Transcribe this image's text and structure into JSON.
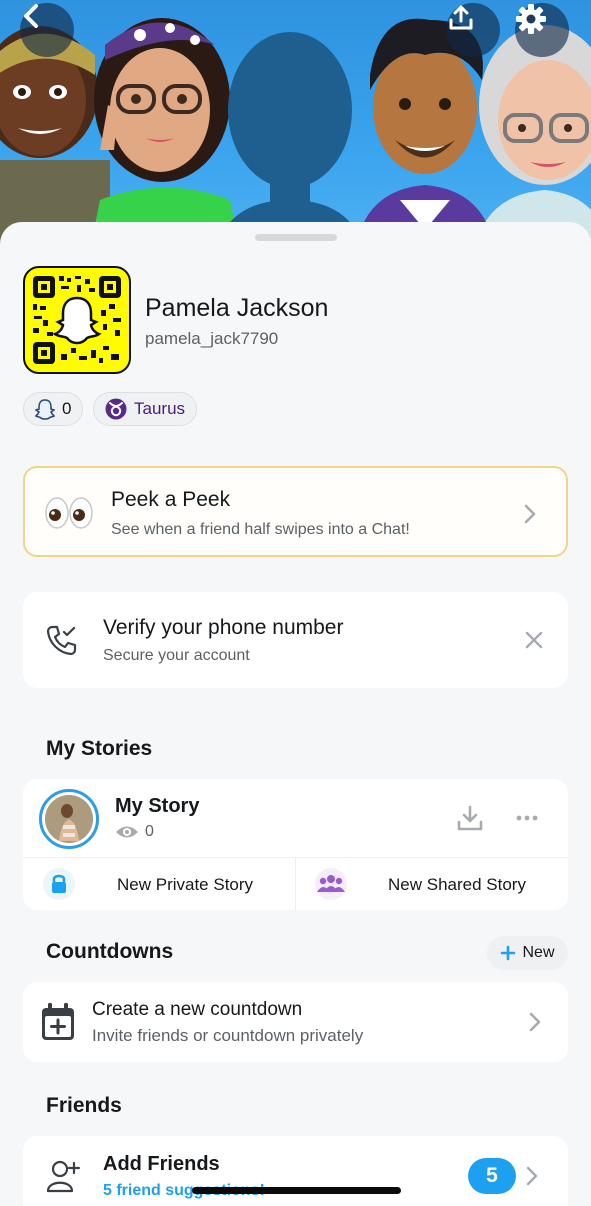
{
  "header": {
    "back_icon": "chevron-left-icon",
    "upload_icon": "upload-icon",
    "settings_icon": "gear-icon"
  },
  "profile": {
    "display_name": "Pamela Jackson",
    "username": "pamela_jack7790",
    "snap_score": "0",
    "zodiac": "Taurus"
  },
  "peek_card": {
    "title": "Peek a Peek",
    "subtitle": "See when a friend half swipes into a Chat!"
  },
  "verify_card": {
    "title": "Verify your phone number",
    "subtitle": "Secure your account"
  },
  "my_stories": {
    "heading": "My Stories",
    "story_title": "My Story",
    "view_count": "0",
    "private_label": "New Private Story",
    "shared_label": "New Shared Story"
  },
  "countdowns": {
    "heading": "Countdowns",
    "new_label": "New",
    "create_title": "Create a new countdown",
    "create_subtitle": "Invite friends or countdown privately"
  },
  "friends": {
    "heading": "Friends",
    "add_title": "Add Friends",
    "add_subtitle": "5 friend suggestions!",
    "badge_count": "5"
  },
  "colors": {
    "banner_blue": "#3aa4ee",
    "snapcode_yellow": "#fffc00",
    "accent_blue": "#1ea0f0",
    "zodiac_purple": "#4a1c7a",
    "peek_border": "#f0d48a"
  }
}
